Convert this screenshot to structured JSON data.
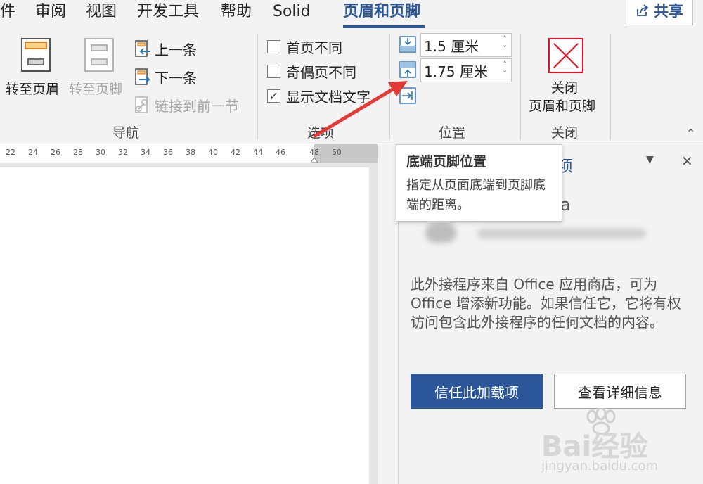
{
  "tabs": [
    {
      "label": "件",
      "active": false
    },
    {
      "label": "审阅",
      "active": false
    },
    {
      "label": "视图",
      "active": false
    },
    {
      "label": "开发工具",
      "active": false
    },
    {
      "label": "帮助",
      "active": false
    },
    {
      "label": "Solid",
      "active": false
    },
    {
      "label": "页眉和页脚",
      "active": true
    }
  ],
  "share_label": "共享",
  "navigation": {
    "goto_header": "转至页眉",
    "goto_footer": "转至页脚",
    "previous": "上一条",
    "next": "下一条",
    "link_previous": "链接到前一节",
    "group_label": "导航"
  },
  "options": {
    "different_first_page": {
      "label": "首页不同",
      "checked": false
    },
    "different_odd_even": {
      "label": "奇偶页不同",
      "checked": false
    },
    "show_document_text": {
      "label": "显示文档文字",
      "checked": true
    },
    "group_label": "选项"
  },
  "position": {
    "header_from_top": "1.5 厘米",
    "footer_from_bottom": "1.75 厘米",
    "group_label": "位置"
  },
  "close": {
    "button_line1": "关闭",
    "button_line2": "页眉和页脚",
    "group_label": "关闭"
  },
  "ruler_ticks": [
    "22",
    "24",
    "26",
    "28",
    "30",
    "32",
    "34",
    "36",
    "38",
    "40",
    "42",
    "44",
    "46",
    "48",
    "50"
  ],
  "tooltip": {
    "title": "底端页脚位置",
    "body": "指定从页面底端到页脚底端的距离。"
  },
  "pane": {
    "description": "此外接程序来自 Office 应用商店，可为 Office 增添新功能。如果信任它，它将有权访问包含此外接程序的任何文档的内容。",
    "trust_button": "信任此加载项",
    "details_button": "查看详细信息",
    "partial_title": "项",
    "partial_text": "a"
  },
  "watermark": {
    "brand": "Bai经验",
    "url": "jingyan.baidu.com"
  },
  "colors": {
    "accent": "#2b579a",
    "close_red": "#e81123",
    "arrow_red": "#e53935",
    "ribbon_bg": "#f3f3f3"
  }
}
